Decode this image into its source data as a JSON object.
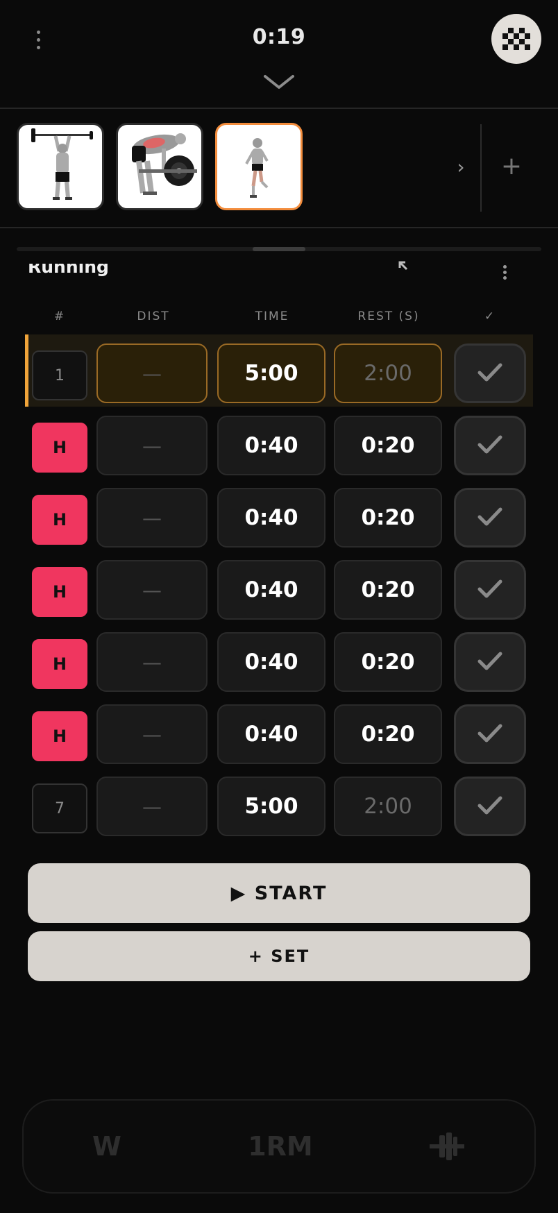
{
  "header": {
    "timer": "0:19"
  },
  "exercise": {
    "title": "Running"
  },
  "strip": {
    "next_glyph": "›",
    "add_glyph": "+"
  },
  "table": {
    "columns": [
      "#",
      "DIST",
      "TIME",
      "REST (S)",
      "✓"
    ],
    "rows": [
      {
        "set": "1",
        "type": "normal",
        "dist": "—",
        "time": "5:00",
        "rest": "2:00",
        "rest_placeholder": true,
        "active": true
      },
      {
        "set": "H",
        "type": "h",
        "dist": "—",
        "time": "0:40",
        "rest": "0:20",
        "rest_placeholder": false,
        "active": false
      },
      {
        "set": "H",
        "type": "h",
        "dist": "—",
        "time": "0:40",
        "rest": "0:20",
        "rest_placeholder": false,
        "active": false
      },
      {
        "set": "H",
        "type": "h",
        "dist": "—",
        "time": "0:40",
        "rest": "0:20",
        "rest_placeholder": false,
        "active": false
      },
      {
        "set": "H",
        "type": "h",
        "dist": "—",
        "time": "0:40",
        "rest": "0:20",
        "rest_placeholder": false,
        "active": false
      },
      {
        "set": "H",
        "type": "h",
        "dist": "—",
        "time": "0:40",
        "rest": "0:20",
        "rest_placeholder": false,
        "active": false
      },
      {
        "set": "7",
        "type": "normal",
        "dist": "—",
        "time": "5:00",
        "rest": "2:00",
        "rest_placeholder": true,
        "active": false
      }
    ]
  },
  "buttons": {
    "start": "▶ START",
    "add_set": "+ SET"
  },
  "bottom_bar": {
    "w": "W",
    "one_rm": "1RM"
  },
  "colors": {
    "accent_orange": "#f0a43a",
    "h_badge": "#f0365f",
    "button_bg": "#d7d3ce"
  }
}
